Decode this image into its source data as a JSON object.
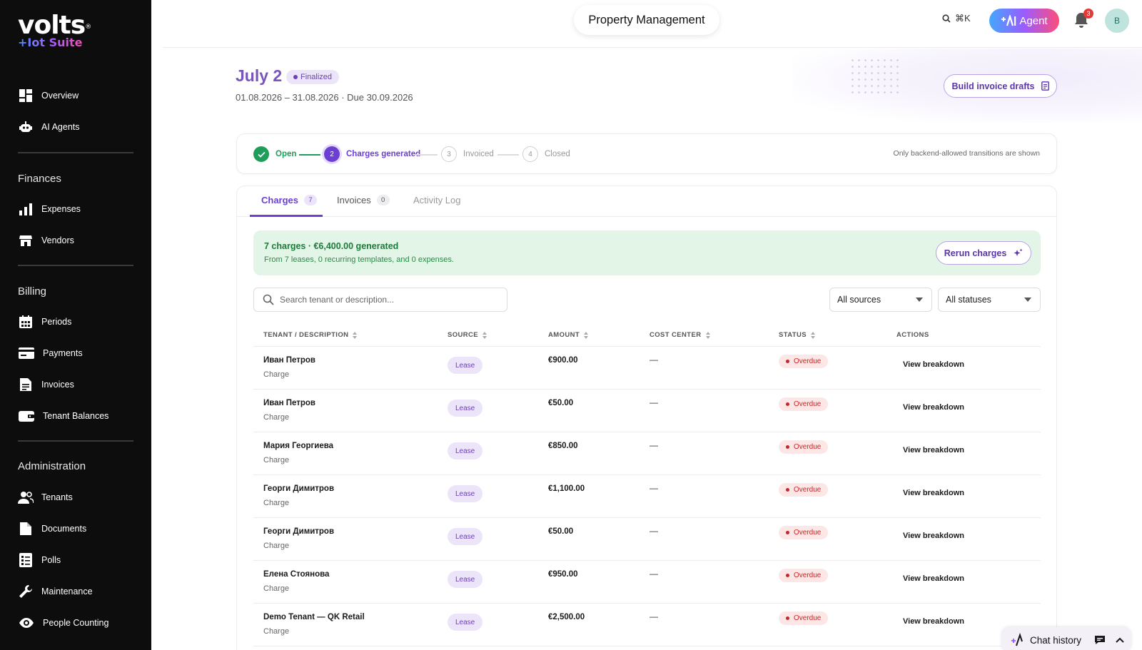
{
  "brand": {
    "name": "volts",
    "tagline": "+Iot Suite",
    "mark": "®"
  },
  "sidebar": {
    "items_top": [
      {
        "label": "Overview",
        "icon": "dashboard-icon"
      },
      {
        "label": "AI Agents",
        "icon": "robot-icon"
      }
    ],
    "sections": [
      {
        "title": "Finances",
        "items": [
          {
            "label": "Expenses",
            "icon": "bar-chart-icon"
          },
          {
            "label": "Vendors",
            "icon": "store-icon"
          }
        ]
      },
      {
        "title": "Billing",
        "items": [
          {
            "label": "Periods",
            "icon": "calendar-icon"
          },
          {
            "label": "Payments",
            "icon": "credit-card-icon"
          },
          {
            "label": "Invoices",
            "icon": "document-icon"
          },
          {
            "label": "Tenant Balances",
            "icon": "wallet-icon"
          }
        ]
      },
      {
        "title": "Administration",
        "items": [
          {
            "label": "Tenants",
            "icon": "people-icon"
          },
          {
            "label": "Documents",
            "icon": "file-icon"
          },
          {
            "label": "Polls",
            "icon": "checklist-icon"
          },
          {
            "label": "Maintenance",
            "icon": "wrench-icon"
          },
          {
            "label": "People Counting",
            "icon": "eye-icon"
          }
        ]
      }
    ]
  },
  "topbar": {
    "title": "Property Management",
    "search_shortcut": "⌘K",
    "agent_label": "Agent",
    "notifications_count": "3",
    "avatar_initial": "B"
  },
  "period": {
    "title": "July 2",
    "status": "Finalized",
    "dates": "01.08.2026 – 31.08.2026 · Due 30.09.2026",
    "build_button": "Build invoice drafts"
  },
  "stepper": {
    "steps": [
      {
        "num": "✓",
        "label": "Open",
        "state": "done"
      },
      {
        "num": "2",
        "label": "Charges generated",
        "state": "active"
      },
      {
        "num": "3",
        "label": "Invoiced",
        "state": "pending"
      },
      {
        "num": "4",
        "label": "Closed",
        "state": "pending"
      }
    ],
    "note": "Only backend-allowed transitions are shown"
  },
  "tabs": [
    {
      "label": "Charges",
      "count": "7",
      "active": true
    },
    {
      "label": "Invoices",
      "count": "0",
      "active": false
    },
    {
      "label": "Activity Log",
      "count": "",
      "active": false
    }
  ],
  "summary": {
    "headline": "7 charges · €6,400.00 generated",
    "detail": "From 7 leases, 0 recurring templates, and 0 expenses.",
    "rerun_button": "Rerun charges"
  },
  "filters": {
    "search_placeholder": "Search tenant or description...",
    "source": "All sources",
    "status": "All statuses"
  },
  "table": {
    "columns": [
      "TENANT / DESCRIPTION",
      "SOURCE",
      "AMOUNT",
      "COST CENTER",
      "STATUS",
      "ACTIONS"
    ],
    "rows": [
      {
        "tenant": "Иван Петров",
        "description": "Charge",
        "source": "Lease",
        "amount": "€900.00",
        "cost_center": "—",
        "status": "Overdue",
        "action": "View breakdown"
      },
      {
        "tenant": "Иван Петров",
        "description": "Charge",
        "source": "Lease",
        "amount": "€50.00",
        "cost_center": "—",
        "status": "Overdue",
        "action": "View breakdown"
      },
      {
        "tenant": "Мария Георгиева",
        "description": "Charge",
        "source": "Lease",
        "amount": "€850.00",
        "cost_center": "—",
        "status": "Overdue",
        "action": "View breakdown"
      },
      {
        "tenant": "Георги Димитров",
        "description": "Charge",
        "source": "Lease",
        "amount": "€1,100.00",
        "cost_center": "—",
        "status": "Overdue",
        "action": "View breakdown"
      },
      {
        "tenant": "Георги Димитров",
        "description": "Charge",
        "source": "Lease",
        "amount": "€50.00",
        "cost_center": "—",
        "status": "Overdue",
        "action": "View breakdown"
      },
      {
        "tenant": "Елена Стоянова",
        "description": "Charge",
        "source": "Lease",
        "amount": "€950.00",
        "cost_center": "—",
        "status": "Overdue",
        "action": "View breakdown"
      },
      {
        "tenant": "Demo Tenant — QK Retail",
        "description": "Charge",
        "source": "Lease",
        "amount": "€2,500.00",
        "cost_center": "—",
        "status": "Overdue",
        "action": "View breakdown"
      }
    ]
  },
  "chat": {
    "label": "Chat history"
  },
  "colors": {
    "accent": "#6b3fd1",
    "success": "#1e9e5a",
    "danger": "#c62828",
    "sidebar": "#0d0d0d"
  }
}
